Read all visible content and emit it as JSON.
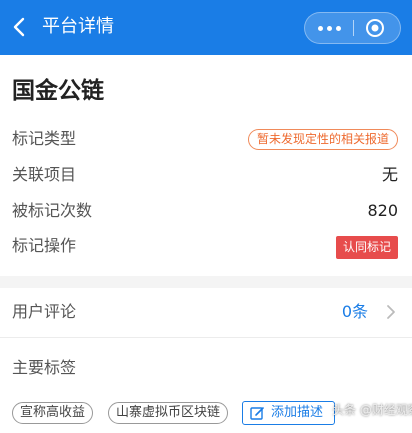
{
  "navbar": {
    "title": "平台详情",
    "background": "#1a7de6",
    "back_icon": "chevron-left-icon",
    "more_icon": "more-dots-icon",
    "close_icon": "target-circle-icon"
  },
  "platform": {
    "name": "国金公链",
    "rows": [
      {
        "label": "标记类型",
        "value": "暂未发现定性的相关报道",
        "value_style": "orange-outline-tag"
      },
      {
        "label": "关联项目",
        "value": "无"
      },
      {
        "label": "被标记次数",
        "value": "820"
      },
      {
        "label": "标记操作",
        "value": "认同标记",
        "value_style": "red-button"
      }
    ]
  },
  "reviews": {
    "label": "用户评论",
    "count": "0条",
    "arrow_icon": "chevron-right-icon"
  },
  "tags": {
    "title": "主要标签",
    "items": [
      "宣称高收益",
      "山寨虚拟币区块链"
    ],
    "add_label": "添加描述",
    "add_icon": "edit-icon"
  },
  "watermark": "头条 @财经观察",
  "colors": {
    "accent": "#1a7de6",
    "warning_orange": "#ee6a2f",
    "danger_red": "#e74c4c"
  }
}
